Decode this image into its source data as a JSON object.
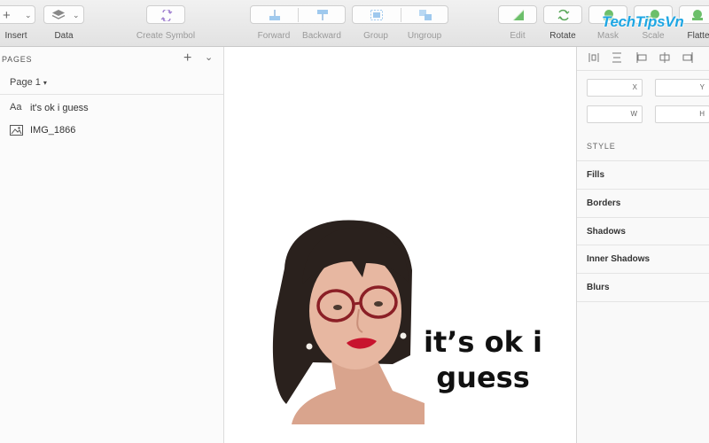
{
  "toolbar": {
    "insert_label": "Insert",
    "insert_glyph": "+",
    "data_label": "Data",
    "create_symbol_label": "Create Symbol",
    "forward_label": "Forward",
    "backward_label": "Backward",
    "group_label": "Group",
    "ungroup_label": "Ungroup",
    "edit_label": "Edit",
    "rotate_label": "Rotate",
    "mask_label": "Mask",
    "scale_label": "Scale",
    "flatten_label": "Flatte",
    "accent_color": "#2f8fdc",
    "green_color": "#4caf50"
  },
  "pages_panel": {
    "title": "PAGES",
    "add_glyph": "+",
    "collapse_glyph": "⌄",
    "current_page": "Page 1",
    "layers": [
      {
        "icon": "Aa",
        "name": "it's ok i guess",
        "type": "text-layer"
      },
      {
        "icon": "🖼",
        "name": "IMG_1866",
        "type": "image-layer"
      }
    ]
  },
  "canvas": {
    "caption_line1": "it’s ok i",
    "caption_line2": "guess"
  },
  "inspector": {
    "x_label": "X",
    "y_label": "Y",
    "w_label": "W",
    "h_label": "H",
    "style_header": "STYLE",
    "rows": [
      "Fills",
      "Borders",
      "Shadows",
      "Inner Shadows",
      "Blurs"
    ]
  },
  "watermark": {
    "text": "TechTipsVn",
    "color": "#1ea6e3"
  }
}
